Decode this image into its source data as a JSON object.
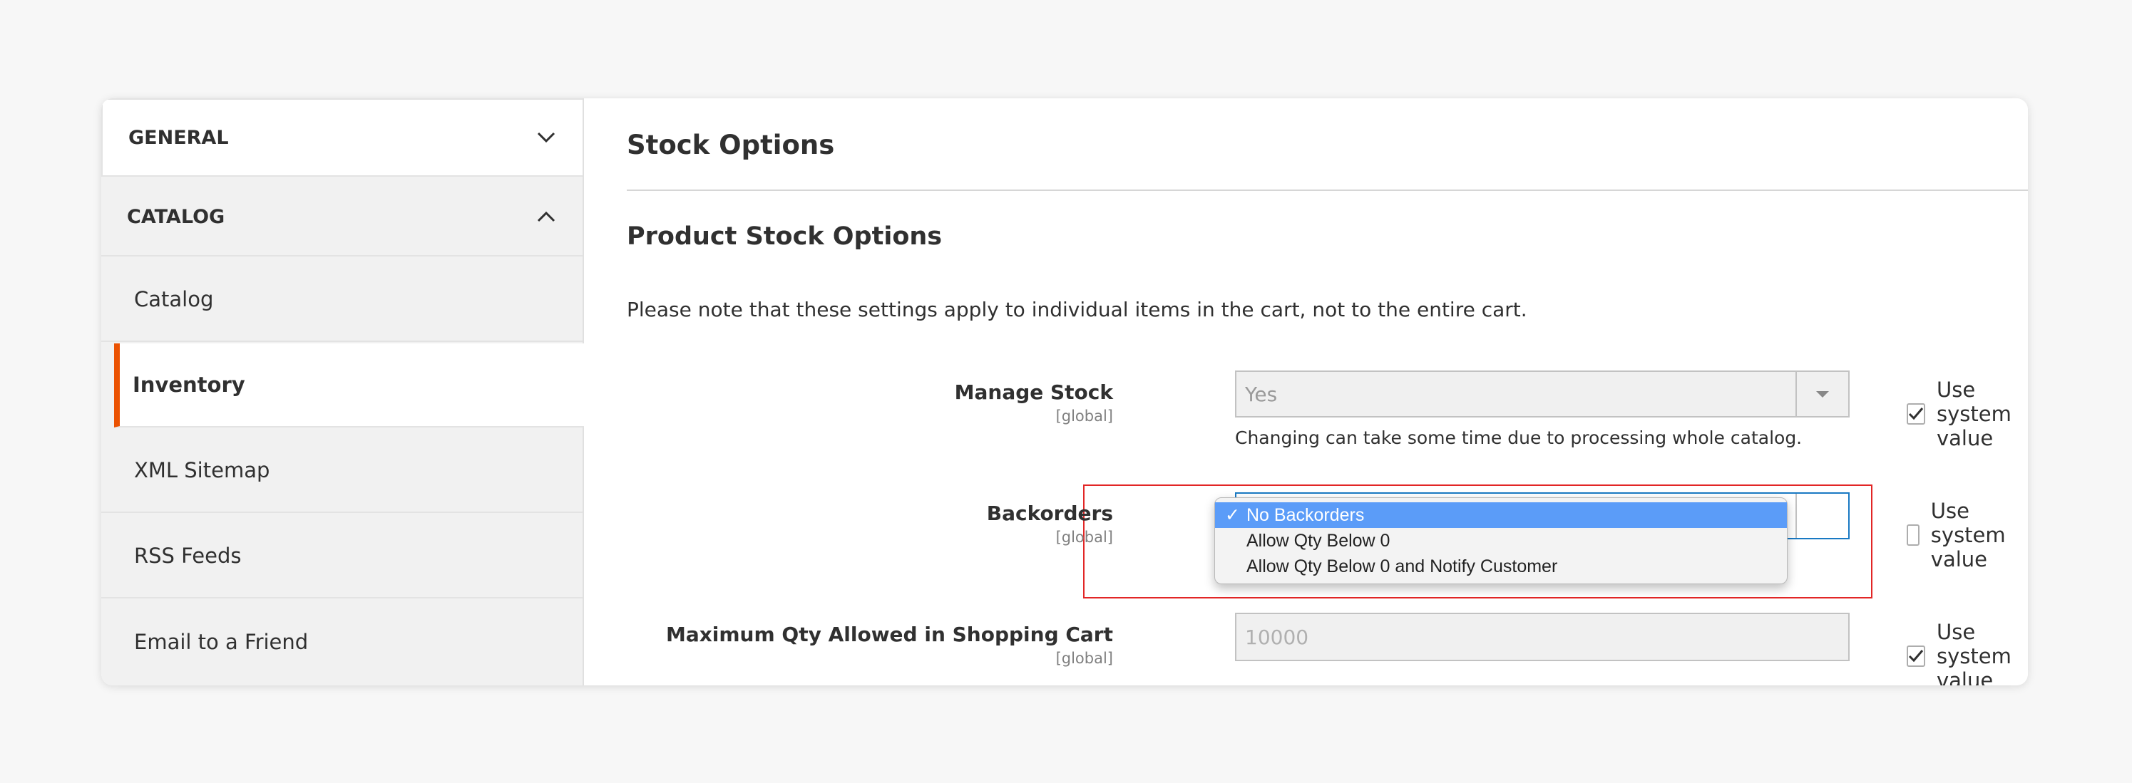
{
  "sidebar": {
    "sections": [
      {
        "label": "GENERAL",
        "state": "collapsed"
      },
      {
        "label": "CATALOG",
        "state": "expanded"
      }
    ],
    "items": [
      {
        "label": "Catalog"
      },
      {
        "label": "Inventory",
        "active": true
      },
      {
        "label": "XML Sitemap"
      },
      {
        "label": "RSS Feeds"
      },
      {
        "label": "Email to a Friend"
      }
    ]
  },
  "main": {
    "title": "Stock Options",
    "subtitle": "Product Stock Options",
    "note": "Please note that these settings apply to individual items in the cart, not to the entire cart.",
    "fields": {
      "manage_stock": {
        "label": "Manage Stock",
        "scope": "[global]",
        "value": "Yes",
        "hint": "Changing can take some time due to processing whole catalog.",
        "use_system_label": "Use system value",
        "use_system_checked": true
      },
      "backorders": {
        "label": "Backorders",
        "scope": "[global]",
        "options": [
          "No Backorders",
          "Allow Qty Below 0",
          "Allow Qty Below 0 and Notify Customer"
        ],
        "selected": "No Backorders",
        "use_system_label": "Use system value",
        "use_system_checked": false
      },
      "max_qty": {
        "label": "Maximum Qty Allowed in Shopping Cart",
        "scope": "[global]",
        "value": "10000",
        "use_system_label": "Use system value",
        "use_system_checked": true
      }
    }
  },
  "colors": {
    "accent": "#eb5202",
    "highlight_border": "#e22626",
    "selected_option": "#5b9cf8"
  }
}
